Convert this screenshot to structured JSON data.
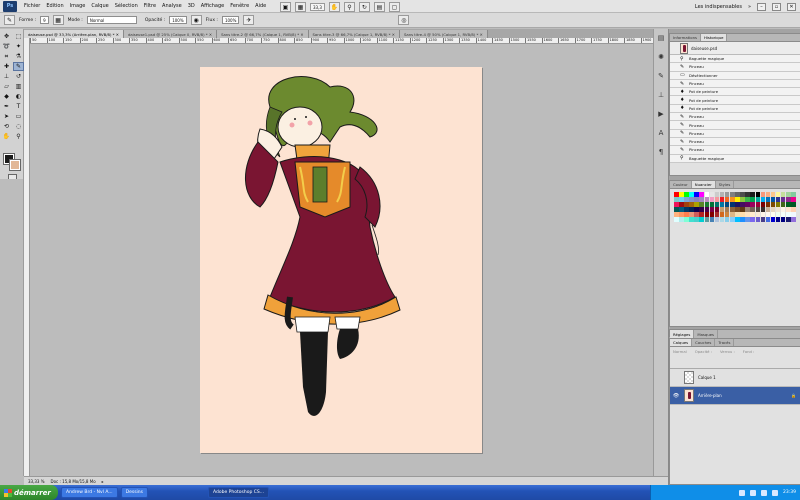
{
  "menubar": {
    "logo": "Ps",
    "items": [
      "Fichier",
      "Edition",
      "Image",
      "Calque",
      "Sélection",
      "Filtre",
      "Analyse",
      "3D",
      "Affichage",
      "Fenêtre",
      "Aide"
    ],
    "zoom": "33,3",
    "workspace": "Les indispensables"
  },
  "options": {
    "forme_label": "Forme :",
    "brush_size": "9",
    "mode_label": "Mode :",
    "mode_value": "Normal",
    "opacite_label": "Opacité :",
    "opacite_value": "100%",
    "flux_label": "Flux :",
    "flux_value": "100%"
  },
  "tabs": [
    "daiseuse.psd @ 33,3% (Arrière-plan, RVB/8) *",
    "daiseuse1.psd @ 25% (Calque 0, RVB/8) *",
    "Sans titre-2 @ 66,7% (Calque 1, RVB/8) *",
    "Sans titre-3 @ 66,7% (Calque 1, RVB/8) *",
    "Sans titre-4 @ 50% (Calque 1, RVB/8) *"
  ],
  "ruler": [
    "50",
    "100",
    "150",
    "200",
    "250",
    "300",
    "350",
    "400",
    "450",
    "500",
    "550",
    "600",
    "650",
    "700",
    "750",
    "800",
    "850",
    "900",
    "950",
    "1000",
    "1050",
    "1100",
    "1150",
    "1200",
    "1250",
    "1300",
    "1350",
    "1400",
    "1450",
    "1500",
    "1550",
    "1600",
    "1650",
    "1700",
    "1750",
    "1800",
    "1850",
    "1900"
  ],
  "status": {
    "zoom": "33,33 %",
    "doc": "Doc : 15,8 Mo/15,8 Mo"
  },
  "history": {
    "tabs": [
      "Informations",
      "Historique"
    ],
    "snapshot": "daiseuse.psd",
    "items": [
      {
        "label": "Baguette magique",
        "icon": "⚲"
      },
      {
        "label": "Pinceau",
        "icon": "✎"
      },
      {
        "label": "Désélectionner",
        "icon": "▭"
      },
      {
        "label": "Pinceau",
        "icon": "✎"
      },
      {
        "label": "Pot de peinture",
        "icon": "♦"
      },
      {
        "label": "Pot de peinture",
        "icon": "♦"
      },
      {
        "label": "Pot de peinture",
        "icon": "♦"
      },
      {
        "label": "Pinceau",
        "icon": "✎"
      },
      {
        "label": "Pinceau",
        "icon": "✎"
      },
      {
        "label": "Pinceau",
        "icon": "✎"
      },
      {
        "label": "Pinceau",
        "icon": "✎"
      },
      {
        "label": "Pinceau",
        "icon": "✎"
      },
      {
        "label": "Baguette magique",
        "icon": "⚲"
      }
    ]
  },
  "swatches_panel": {
    "tabs": [
      "Couleur",
      "Nuancier",
      "Styles"
    ],
    "colors": [
      "#ff0000",
      "#ffff00",
      "#00ff00",
      "#00ffff",
      "#0000ff",
      "#ff00ff",
      "#ffffff",
      "#e6e6e6",
      "#cccccc",
      "#b3b3b3",
      "#999999",
      "#808080",
      "#666666",
      "#4d4d4d",
      "#333333",
      "#1a1a1a",
      "#000000",
      "#f7977a",
      "#f9ad81",
      "#fdc68a",
      "#fff79a",
      "#c4df9b",
      "#a2d39c",
      "#82ca9d",
      "#7bcdc8",
      "#6ecff6",
      "#7ea7d8",
      "#8493ca",
      "#8882be",
      "#a187be",
      "#bc8dbf",
      "#f49ac2",
      "#f6989d",
      "#ed1c24",
      "#f26522",
      "#f7941d",
      "#fff200",
      "#8dc73f",
      "#39b54a",
      "#00a651",
      "#00a99d",
      "#00aeef",
      "#0072bc",
      "#0054a6",
      "#2e3192",
      "#662d91",
      "#92278f",
      "#ec008c",
      "#ed145b",
      "#9e0b0f",
      "#a0410d",
      "#a3620a",
      "#aba000",
      "#598527",
      "#1a7b30",
      "#007236",
      "#00746b",
      "#0076a3",
      "#004b80",
      "#003471",
      "#1b1464",
      "#440e62",
      "#630460",
      "#9e005d",
      "#9e0039",
      "#790000",
      "#7b2e00",
      "#7d4900",
      "#827b00",
      "#406618",
      "#005e20",
      "#005826",
      "#005952",
      "#005b7f",
      "#003663",
      "#002157",
      "#0d004c",
      "#32004b",
      "#4b0049",
      "#7b0046",
      "#7a0026",
      "#c69c6d",
      "#a67c52",
      "#8c6239",
      "#754c24",
      "#603913",
      "#998675",
      "#736357",
      "#534741",
      "#362f2d",
      "#c7b299",
      "#e6d7c0",
      "#f2e6d4",
      "#fbf4e8",
      "#ffe4d0",
      "#ffd1b3",
      "#ffb380",
      "#ff9966",
      "#ff7f50",
      "#e9967a",
      "#cd5c5c",
      "#b22222",
      "#8b0000",
      "#800000",
      "#a52a2a",
      "#d2691e",
      "#cd853f",
      "#deb887",
      "#f5deb3",
      "#ffdead",
      "#ffe4c4",
      "#ffebcd",
      "#faebd7",
      "#fdf5e6",
      "#fffaf0",
      "#fffff0",
      "#f0fff0",
      "#f5fffa",
      "#f0ffff",
      "#f0f8ff",
      "#e0ffff",
      "#afeeee",
      "#7fffd4",
      "#40e0d0",
      "#48d1cc",
      "#00ced1",
      "#5f9ea0",
      "#4682b4",
      "#b0c4de",
      "#add8e6",
      "#87ceeb",
      "#87cefa",
      "#00bfff",
      "#1e90ff",
      "#6495ed",
      "#7b68ee",
      "#6a5acd",
      "#483d8b",
      "#4169e1",
      "#0000cd",
      "#00008b",
      "#000080",
      "#191970",
      "#9370db"
    ]
  },
  "adjust_panel": {
    "tabs": [
      "Réglages",
      "Masques"
    ]
  },
  "layers": {
    "tabs": [
      "Calques",
      "Couches",
      "Tracés"
    ],
    "blend": "Normal",
    "opacity_label": "Opacité :",
    "lock_label": "Verrou :",
    "fill_label": "Fond :",
    "rows": [
      {
        "name": "Calque 1",
        "type": "layer",
        "visible": false
      },
      {
        "name": "Arrière-plan",
        "type": "background",
        "visible": true
      }
    ]
  },
  "taskbar": {
    "start": "démarrer",
    "tasks": [
      "Andrew Brd - Nvl A...",
      "Dessins",
      "Adobe Photoshop CS..."
    ],
    "time": "23:39"
  }
}
